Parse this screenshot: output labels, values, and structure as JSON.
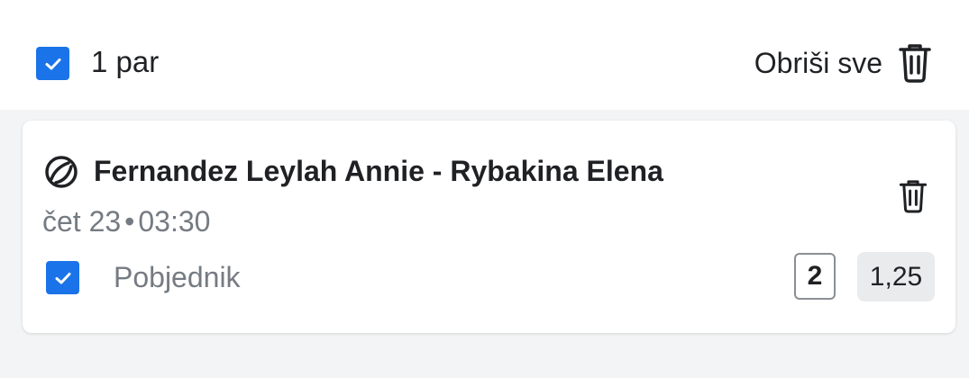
{
  "header": {
    "pair_count": "1 par",
    "clear_all_label": "Obriši sve",
    "select_all_checked": true
  },
  "match": {
    "sport_icon": "tennis-ball-icon",
    "title": "Fernandez Leylah Annie - Rybakina Elena",
    "day": "čet 23",
    "separator": "•",
    "time": "03:30",
    "selection_label": "Pobjednik",
    "selection_checked": true,
    "outcome": "2",
    "odds": "1,25"
  },
  "colors": {
    "accent": "#1a73e8",
    "text": "#1f2124",
    "muted": "#757b82",
    "odds_bg": "#e9ebed"
  }
}
